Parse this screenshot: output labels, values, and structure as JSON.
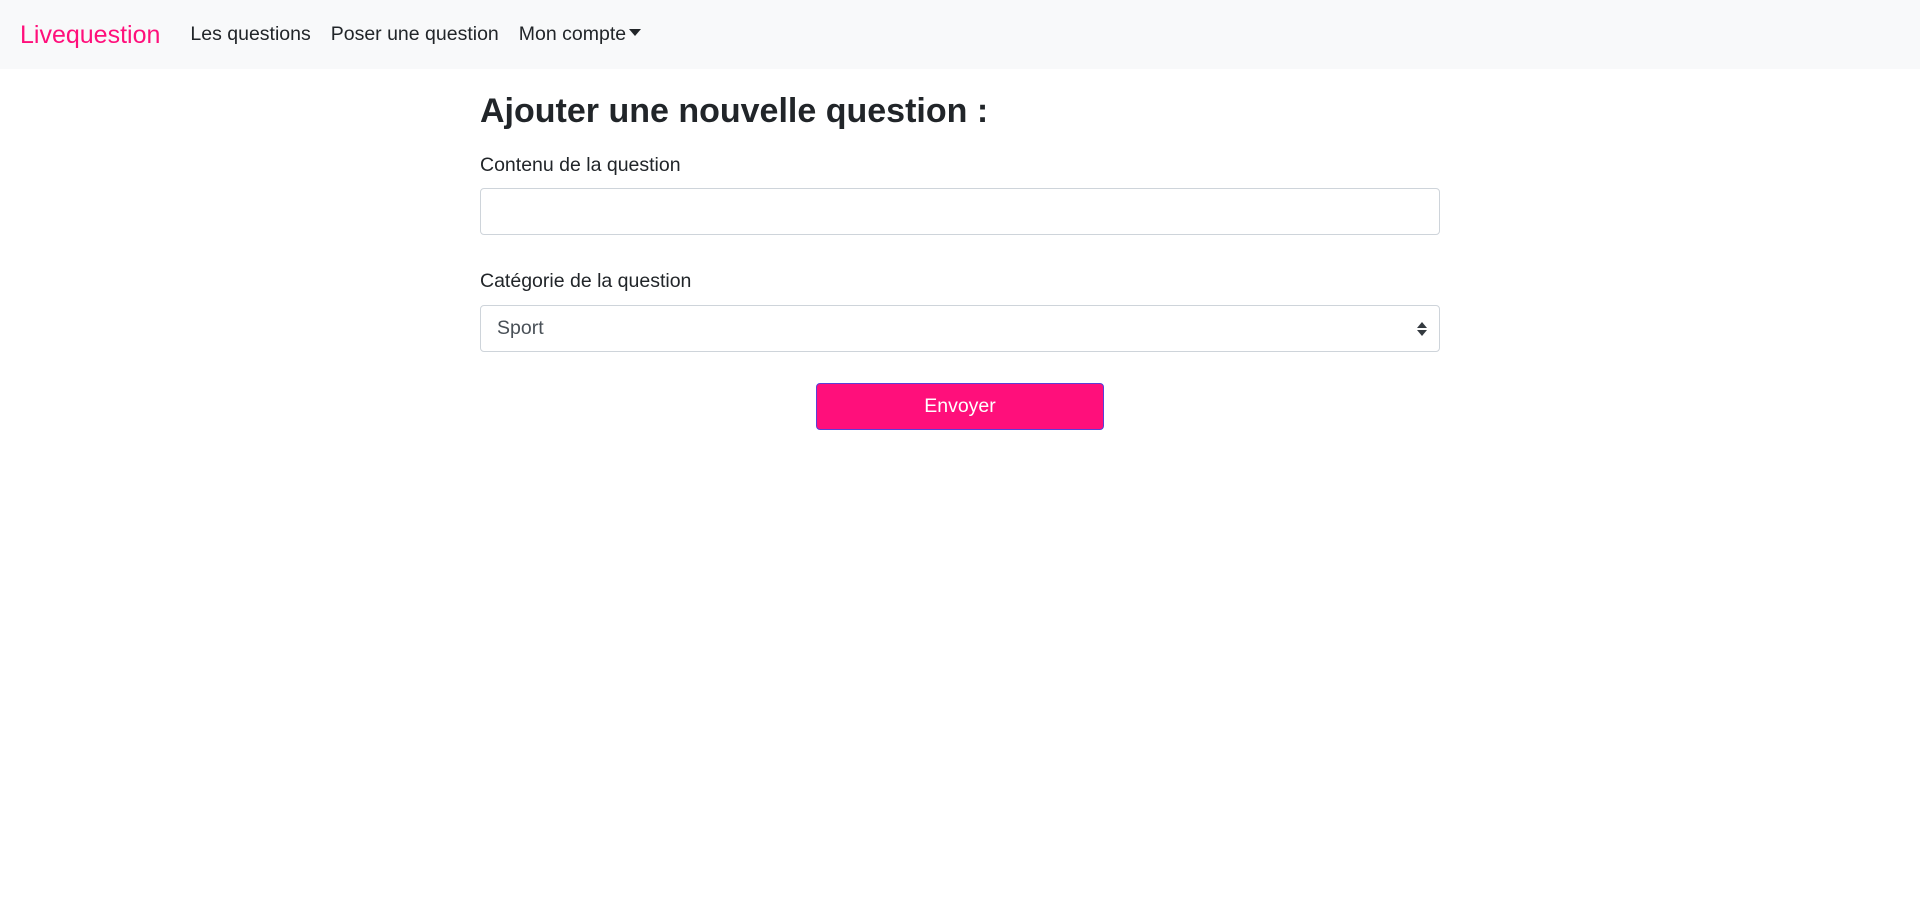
{
  "navbar": {
    "brand": "Livequestion",
    "links": [
      {
        "label": "Les questions"
      },
      {
        "label": "Poser une question"
      },
      {
        "label": "Mon compte"
      }
    ]
  },
  "form": {
    "title": "Ajouter une nouvelle question :",
    "content_label": "Contenu de la question",
    "content_value": "",
    "category_label": "Catégorie de la question",
    "category_selected": "Sport",
    "submit_label": "Envoyer"
  },
  "colors": {
    "brand": "#ff0f7b",
    "navbar_bg": "#f8f9fa",
    "button_bg": "#ff0f7b",
    "button_border": "#5a3fd6"
  }
}
